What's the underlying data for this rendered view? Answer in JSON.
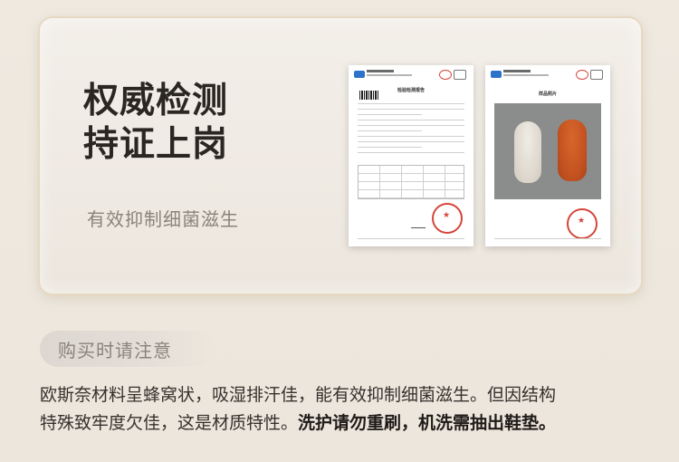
{
  "headline": {
    "line1": "权威检测",
    "line2": "持证上岗"
  },
  "subhead": "有效抑制细菌滋生",
  "documents": {
    "report_title": "检验检测报告",
    "photo_title": "样品照片"
  },
  "notice": {
    "label": "购买时请注意",
    "line1": "欧斯奈材料呈蜂窝状，吸湿排汗佳，能有效抑制细菌滋生。但因结构",
    "line2_normal": "特殊致牢度欠佳，这是材质特性。",
    "line2_bold": "洗护请勿重刷，机洗需抽出鞋垫。"
  },
  "colors": {
    "headline": "#2a2622",
    "muted": "#8a837c",
    "stamp": "#d6453a",
    "insole_orange": "#c55321"
  }
}
